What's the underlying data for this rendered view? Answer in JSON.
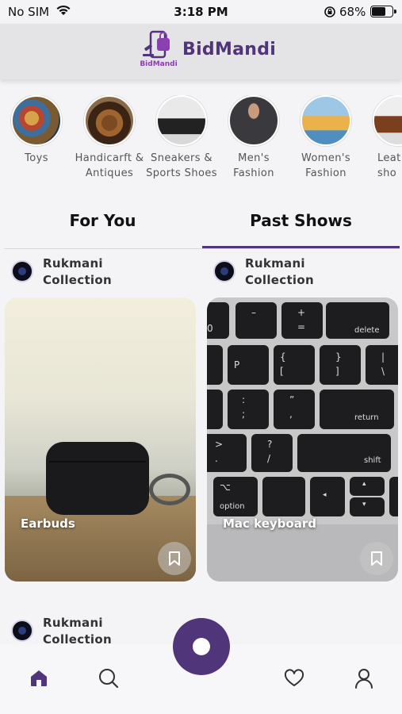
{
  "status_bar": {
    "carrier": "No SIM",
    "time": "3:18 PM",
    "battery_percent": "68%",
    "battery_level": 0.68
  },
  "header": {
    "logo_text": "BidMandi",
    "brand": "BidMandi"
  },
  "categories": [
    {
      "label_line1": "Toys",
      "label_line2": "",
      "icon": "toys-image"
    },
    {
      "label_line1": "Handicarft &",
      "label_line2": "Antiques",
      "icon": "handicraft-image"
    },
    {
      "label_line1": "Sneakers &",
      "label_line2": "Sports Shoes",
      "icon": "sneakers-image"
    },
    {
      "label_line1": "Men's",
      "label_line2": "Fashion",
      "icon": "mens-fashion-image"
    },
    {
      "label_line1": "Women's",
      "label_line2": "Fashion",
      "icon": "womens-fashion-image"
    },
    {
      "label_line1": "Leat",
      "label_line2": "sho",
      "icon": "leather-shoes-image"
    }
  ],
  "tabs": [
    {
      "label": "For You",
      "active": false
    },
    {
      "label": "Past Shows",
      "active": true
    }
  ],
  "cards": [
    {
      "seller_line1": "Rukmani",
      "seller_line2": "Collection",
      "title": "Earbuds"
    },
    {
      "seller_line1": "Rukmani",
      "seller_line2": "Collection",
      "title": "Mac keyboard"
    }
  ],
  "peek_card": {
    "seller_line1": "Rukmani",
    "seller_line2": "Collection"
  },
  "keyboard_keys": {
    "minus": "–",
    "plus": "+",
    "equals": "=",
    "delete": "delete",
    "p": "P",
    "brace_open": "{",
    "bracket_open": "[",
    "brace_close": "}",
    "bracket_close": "]",
    "pipe": "|",
    "backslash": "\\",
    "colon": ":",
    "semicolon": ";",
    "quote": "”",
    "apostrophe": ",",
    "return": "return",
    "greater": ">",
    "period": ".",
    "question": "?",
    "slash": "/",
    "shift": "shift",
    "option": "option",
    "option_symbol": "⌥"
  },
  "colors": {
    "brand": "#51357a",
    "logo_accent": "#8b3fb0"
  },
  "bottom_nav": [
    "home-icon",
    "search-icon",
    "record-live-icon",
    "heart-icon",
    "profile-icon"
  ]
}
